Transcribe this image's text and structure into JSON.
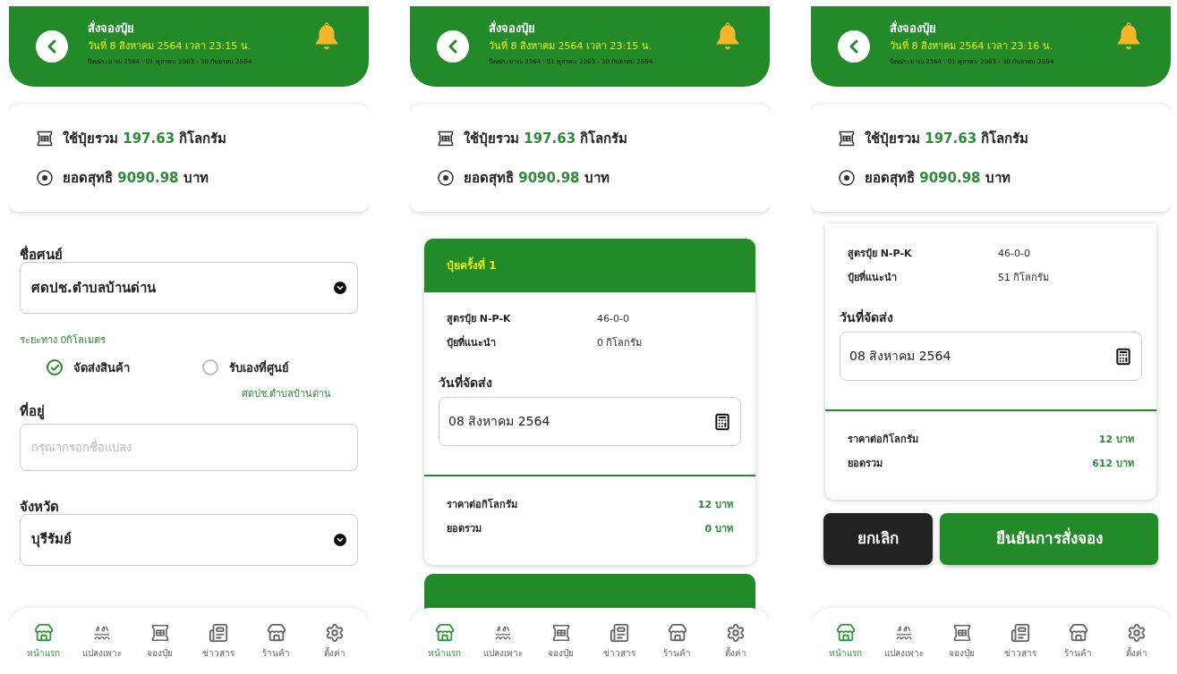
{
  "screens": [
    {
      "kind": "address_form",
      "header": {
        "title": "สั่งจองปุ๋ย",
        "datetime": "วันที่ 8 สิงหาคม 2564 เวลา 23:15 น.",
        "fiscal_year": "ปีงบประมาณ 2564 : 01 ตุลาคม 2563 - 30 กันยายน 2564"
      },
      "summary": {
        "fertilizer": {
          "label": "ใช้ปุ๋ยรวม",
          "value": "197.63",
          "unit": "กิโลกรัม"
        },
        "net": {
          "label": "ยอดสุทธิ",
          "value": "9090.98",
          "unit": "บาท"
        }
      },
      "form": {
        "center": {
          "label": "ชื่อศนย์",
          "value": "ศดปช.ตำบลบ้านด่าน"
        },
        "distance": "ระยะทาง 0กิโลเมตร",
        "delivery_options": [
          {
            "label": "จัดส่งสินค้า",
            "selected": true
          },
          {
            "label": "รับเองที่ศูนย์",
            "selected": false
          }
        ],
        "pickup_center": "ศดปช.ตำบลบ้านด่าน",
        "address": {
          "label": "ที่อยู่",
          "placeholder": "กรุณากรอกชื่อแปลง"
        },
        "province": {
          "label": "จังหวัด",
          "value": "บุรีรัมย์"
        }
      },
      "nav": [
        {
          "label": "หน้าแรก",
          "selected": true
        },
        {
          "label": "แปลงเพาะ",
          "selected": false
        },
        {
          "label": "จองปุ๋ย",
          "selected": false
        },
        {
          "label": "ข่าวสาร",
          "selected": false
        },
        {
          "label": "ร้านค้า",
          "selected": false
        },
        {
          "label": "ตั้งค่า",
          "selected": false
        }
      ]
    },
    {
      "kind": "order_card",
      "header": {
        "title": "สั่งจองปุ๋ย",
        "datetime": "วันที่ 8 สิงหาคม 2564 เวลา 23:15 น.",
        "fiscal_year": "ปีงบประมาณ 2564 : 01 ตุลาคม 2563 - 30 กันยายน 2564"
      },
      "summary": {
        "fertilizer": {
          "label": "ใช้ปุ๋ยรวม",
          "value": "197.63",
          "unit": "กิโลกรัม"
        },
        "net": {
          "label": "ยอดสุทธิ",
          "value": "9090.98",
          "unit": "บาท"
        }
      },
      "card": {
        "title": "ปุ๋ยครั้งที่ 1",
        "rows": [
          {
            "label": "สูตรปุ๋ย N-P-K",
            "value": "46-0-0"
          },
          {
            "label": "ปุ๋ยที่แนะนำ",
            "value": "0 กิโลกรัม"
          }
        ],
        "date": {
          "label": "วันที่จัดส่ง",
          "value": "08 สิงหาคม 2564"
        },
        "prices": [
          {
            "label": "ราคาต่อกิโลกรัม",
            "value": "12 บาท"
          },
          {
            "label": "ยอดรวม",
            "value": "0 บาท"
          }
        ]
      },
      "next_card": true,
      "nav": [
        {
          "label": "หน้าแรก",
          "selected": true
        },
        {
          "label": "แปลงเพาะ",
          "selected": false
        },
        {
          "label": "จองปุ๋ย",
          "selected": false
        },
        {
          "label": "ข่าวสาร",
          "selected": false
        },
        {
          "label": "ร้านค้า",
          "selected": false
        },
        {
          "label": "ตั้งค่า",
          "selected": false
        }
      ]
    },
    {
      "kind": "order_card",
      "header": {
        "title": "สั่งจองปุ๋ย",
        "datetime": "วันที่ 8 สิงหาคม 2564 เวลา 23:16 น.",
        "fiscal_year": "ปีงบประมาณ 2564 : 01 ตุลาคม 2563 - 30 กันยายน 2564"
      },
      "summary": {
        "fertilizer": {
          "label": "ใช้ปุ๋ยรวม",
          "value": "197.63",
          "unit": "กิโลกรัม"
        },
        "net": {
          "label": "ยอดสุทธิ",
          "value": "9090.98",
          "unit": "บาท"
        }
      },
      "card": {
        "rows": [
          {
            "label": "สูตรปุ๋ย N-P-K",
            "value": "46-0-0"
          },
          {
            "label": "ปุ๋ยที่แนะนำ",
            "value": "51 กิโลกรัม"
          }
        ],
        "date": {
          "label": "วันที่จัดส่ง",
          "value": "08 สิงหาคม 2564"
        },
        "prices": [
          {
            "label": "ราคาต่อกิโลกรัม",
            "value": "12 บาท"
          },
          {
            "label": "ยอดรวม",
            "value": "612 บาท"
          }
        ]
      },
      "buttons": [
        {
          "label": "ยกเลิก",
          "kind": "cancel"
        },
        {
          "label": "ยืนยันการสั่งจอง",
          "kind": "confirm"
        }
      ],
      "nav": [
        {
          "label": "หน้าแรก",
          "selected": true
        },
        {
          "label": "แปลงเพาะ",
          "selected": false
        },
        {
          "label": "จองปุ๋ย",
          "selected": false
        },
        {
          "label": "ข่าวสาร",
          "selected": false
        },
        {
          "label": "ร้านค้า",
          "selected": false
        },
        {
          "label": "ตั้งค่า",
          "selected": false
        }
      ]
    }
  ]
}
